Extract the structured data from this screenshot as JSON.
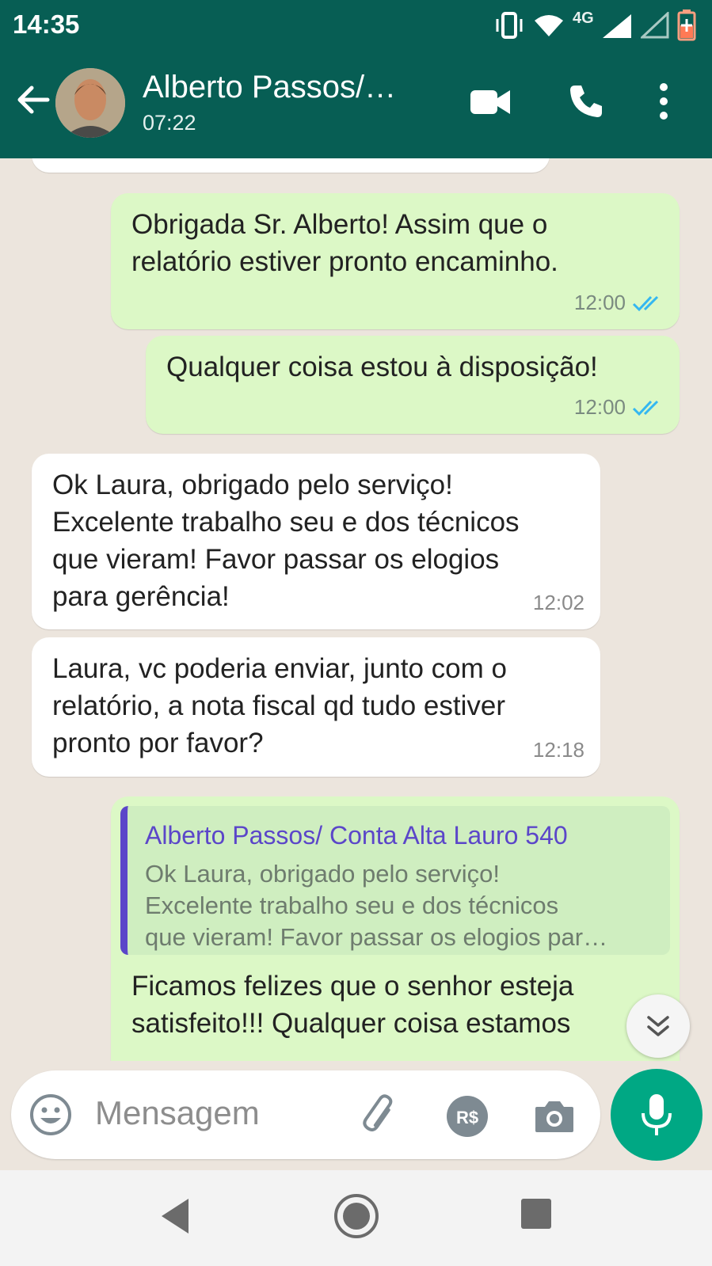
{
  "status_bar": {
    "time": "14:35",
    "network": "4G"
  },
  "header": {
    "contact_name": "Alberto Passos/…",
    "contact_subtitle": "07:22"
  },
  "messages": [
    {
      "direction": "outgoing",
      "text": "Obrigada Sr. Alberto! Assim que o\nrelatório estiver pronto encaminho.",
      "time": "12:00",
      "status": "read"
    },
    {
      "direction": "outgoing",
      "text": "Qualquer coisa estou à disposição!",
      "time": "12:00",
      "status": "read"
    },
    {
      "direction": "incoming",
      "text": "Ok Laura, obrigado pelo serviço!\nExcelente trabalho seu e dos técnicos\nque vieram! Favor passar os elogios\npara gerência!",
      "time": "12:02"
    },
    {
      "direction": "incoming",
      "text": "Laura, vc poderia enviar, junto com o\nrelatório, a nota fiscal qd tudo estiver\npronto por favor?",
      "time": "12:18"
    },
    {
      "direction": "outgoing",
      "quoted_author": "Alberto Passos/ Conta Alta Lauro 540",
      "quoted_text": "Ok Laura, obrigado pelo serviço!\nExcelente trabalho seu e dos técnicos\nque vieram! Favor passar os elogios par…",
      "text": "Ficamos felizes que o senhor esteja\nsatisfeito!!! Qualquer coisa estamos"
    }
  ],
  "composer": {
    "placeholder": "Mensagem"
  },
  "colors": {
    "header": "#075e54",
    "outgoing_bubble": "#dcf8c6",
    "incoming_bubble": "#ffffff",
    "read_ticks": "#34b7f1",
    "mic_button": "#00a884",
    "quote_accent": "#5b46c9"
  },
  "icons": [
    "back-arrow-icon",
    "video-call-icon",
    "voice-call-icon",
    "more-options-icon",
    "emoji-icon",
    "attach-icon",
    "payment-icon",
    "camera-icon",
    "mic-icon",
    "scroll-down-icon",
    "nav-back-icon",
    "nav-home-icon",
    "nav-recents-icon"
  ]
}
